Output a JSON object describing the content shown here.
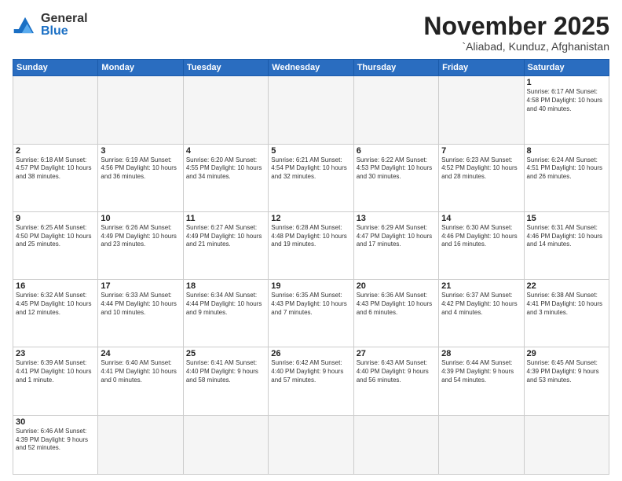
{
  "logo": {
    "general": "General",
    "blue": "Blue"
  },
  "title": "November 2025",
  "subtitle": "`Aliabad, Kunduz, Afghanistan",
  "weekdays": [
    "Sunday",
    "Monday",
    "Tuesday",
    "Wednesday",
    "Thursday",
    "Friday",
    "Saturday"
  ],
  "weeks": [
    [
      {
        "day": "",
        "info": ""
      },
      {
        "day": "",
        "info": ""
      },
      {
        "day": "",
        "info": ""
      },
      {
        "day": "",
        "info": ""
      },
      {
        "day": "",
        "info": ""
      },
      {
        "day": "",
        "info": ""
      },
      {
        "day": "1",
        "info": "Sunrise: 6:17 AM\nSunset: 4:58 PM\nDaylight: 10 hours\nand 40 minutes."
      }
    ],
    [
      {
        "day": "2",
        "info": "Sunrise: 6:18 AM\nSunset: 4:57 PM\nDaylight: 10 hours\nand 38 minutes."
      },
      {
        "day": "3",
        "info": "Sunrise: 6:19 AM\nSunset: 4:56 PM\nDaylight: 10 hours\nand 36 minutes."
      },
      {
        "day": "4",
        "info": "Sunrise: 6:20 AM\nSunset: 4:55 PM\nDaylight: 10 hours\nand 34 minutes."
      },
      {
        "day": "5",
        "info": "Sunrise: 6:21 AM\nSunset: 4:54 PM\nDaylight: 10 hours\nand 32 minutes."
      },
      {
        "day": "6",
        "info": "Sunrise: 6:22 AM\nSunset: 4:53 PM\nDaylight: 10 hours\nand 30 minutes."
      },
      {
        "day": "7",
        "info": "Sunrise: 6:23 AM\nSunset: 4:52 PM\nDaylight: 10 hours\nand 28 minutes."
      },
      {
        "day": "8",
        "info": "Sunrise: 6:24 AM\nSunset: 4:51 PM\nDaylight: 10 hours\nand 26 minutes."
      }
    ],
    [
      {
        "day": "9",
        "info": "Sunrise: 6:25 AM\nSunset: 4:50 PM\nDaylight: 10 hours\nand 25 minutes."
      },
      {
        "day": "10",
        "info": "Sunrise: 6:26 AM\nSunset: 4:49 PM\nDaylight: 10 hours\nand 23 minutes."
      },
      {
        "day": "11",
        "info": "Sunrise: 6:27 AM\nSunset: 4:49 PM\nDaylight: 10 hours\nand 21 minutes."
      },
      {
        "day": "12",
        "info": "Sunrise: 6:28 AM\nSunset: 4:48 PM\nDaylight: 10 hours\nand 19 minutes."
      },
      {
        "day": "13",
        "info": "Sunrise: 6:29 AM\nSunset: 4:47 PM\nDaylight: 10 hours\nand 17 minutes."
      },
      {
        "day": "14",
        "info": "Sunrise: 6:30 AM\nSunset: 4:46 PM\nDaylight: 10 hours\nand 16 minutes."
      },
      {
        "day": "15",
        "info": "Sunrise: 6:31 AM\nSunset: 4:46 PM\nDaylight: 10 hours\nand 14 minutes."
      }
    ],
    [
      {
        "day": "16",
        "info": "Sunrise: 6:32 AM\nSunset: 4:45 PM\nDaylight: 10 hours\nand 12 minutes."
      },
      {
        "day": "17",
        "info": "Sunrise: 6:33 AM\nSunset: 4:44 PM\nDaylight: 10 hours\nand 10 minutes."
      },
      {
        "day": "18",
        "info": "Sunrise: 6:34 AM\nSunset: 4:44 PM\nDaylight: 10 hours\nand 9 minutes."
      },
      {
        "day": "19",
        "info": "Sunrise: 6:35 AM\nSunset: 4:43 PM\nDaylight: 10 hours\nand 7 minutes."
      },
      {
        "day": "20",
        "info": "Sunrise: 6:36 AM\nSunset: 4:43 PM\nDaylight: 10 hours\nand 6 minutes."
      },
      {
        "day": "21",
        "info": "Sunrise: 6:37 AM\nSunset: 4:42 PM\nDaylight: 10 hours\nand 4 minutes."
      },
      {
        "day": "22",
        "info": "Sunrise: 6:38 AM\nSunset: 4:41 PM\nDaylight: 10 hours\nand 3 minutes."
      }
    ],
    [
      {
        "day": "23",
        "info": "Sunrise: 6:39 AM\nSunset: 4:41 PM\nDaylight: 10 hours\nand 1 minute."
      },
      {
        "day": "24",
        "info": "Sunrise: 6:40 AM\nSunset: 4:41 PM\nDaylight: 10 hours\nand 0 minutes."
      },
      {
        "day": "25",
        "info": "Sunrise: 6:41 AM\nSunset: 4:40 PM\nDaylight: 9 hours\nand 58 minutes."
      },
      {
        "day": "26",
        "info": "Sunrise: 6:42 AM\nSunset: 4:40 PM\nDaylight: 9 hours\nand 57 minutes."
      },
      {
        "day": "27",
        "info": "Sunrise: 6:43 AM\nSunset: 4:40 PM\nDaylight: 9 hours\nand 56 minutes."
      },
      {
        "day": "28",
        "info": "Sunrise: 6:44 AM\nSunset: 4:39 PM\nDaylight: 9 hours\nand 54 minutes."
      },
      {
        "day": "29",
        "info": "Sunrise: 6:45 AM\nSunset: 4:39 PM\nDaylight: 9 hours\nand 53 minutes."
      }
    ],
    [
      {
        "day": "30",
        "info": "Sunrise: 6:46 AM\nSunset: 4:39 PM\nDaylight: 9 hours\nand 52 minutes."
      },
      {
        "day": "",
        "info": ""
      },
      {
        "day": "",
        "info": ""
      },
      {
        "day": "",
        "info": ""
      },
      {
        "day": "",
        "info": ""
      },
      {
        "day": "",
        "info": ""
      },
      {
        "day": "",
        "info": ""
      }
    ]
  ]
}
